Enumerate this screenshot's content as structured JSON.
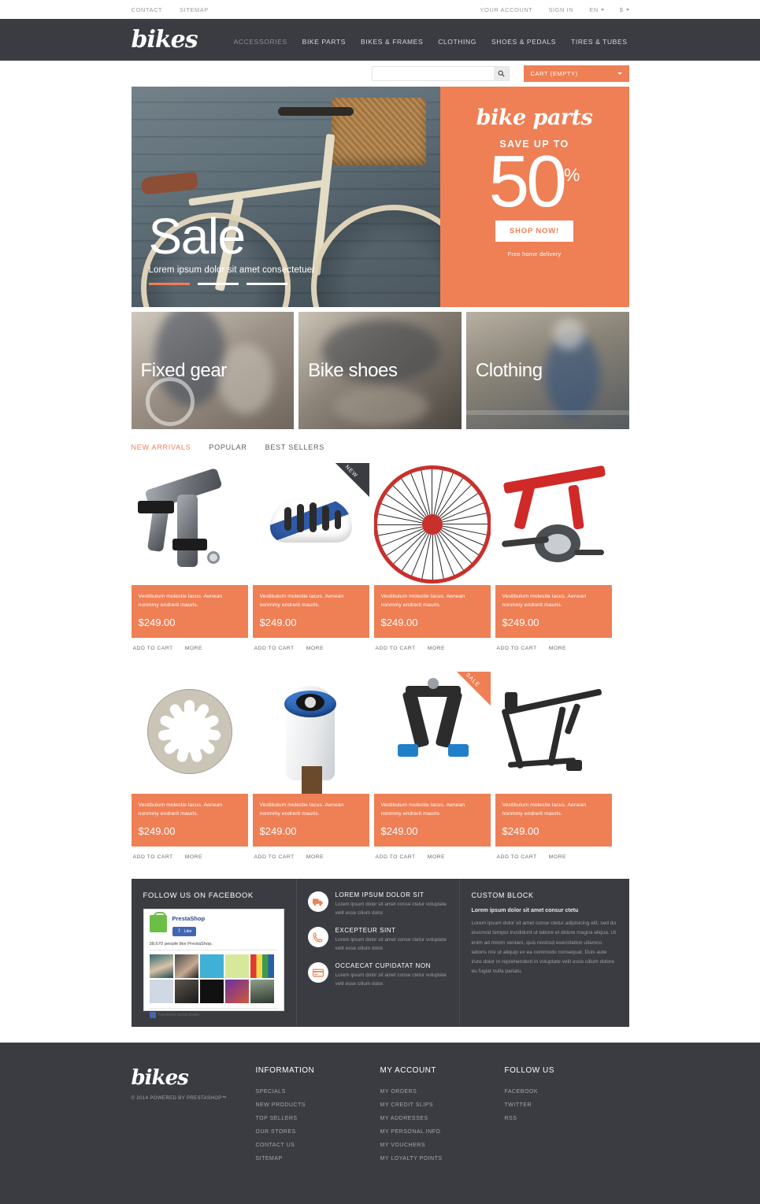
{
  "topbar": {
    "left": [
      {
        "label": "CONTACT"
      },
      {
        "label": "SITEMAP"
      }
    ],
    "right": [
      {
        "label": "YOUR ACCOUNT"
      },
      {
        "label": "SIGN IN"
      }
    ],
    "language": "EN",
    "currency": "$"
  },
  "header": {
    "logo": "bikes",
    "nav": [
      {
        "label": "ACCESSORIES",
        "active": true
      },
      {
        "label": "BIKE PARTS",
        "active": false
      },
      {
        "label": "BIKES & FRAMES",
        "active": false
      },
      {
        "label": "CLOTHING",
        "active": false
      },
      {
        "label": "SHOES & PEDALS",
        "active": false
      },
      {
        "label": "TIRES & TUBES",
        "active": false
      }
    ]
  },
  "search": {
    "value": "",
    "placeholder": "",
    "icon": "search-icon"
  },
  "cart": {
    "label": "CART (EMPTY)"
  },
  "hero": {
    "title": "Sale",
    "subtitle": "Lorem ipsum dolor sit amet consectetuer",
    "slides": 3,
    "active_slide": 1,
    "promo": {
      "script": "bike parts",
      "save_up_to": "SAVE UP TO",
      "percent_number": "50",
      "percent_symbol": "%",
      "button": "SHOP NOW!",
      "note": "Free home delivery",
      "bg_color": "#ef7f55"
    }
  },
  "categories": [
    {
      "label": "Fixed gear"
    },
    {
      "label": "Bike shoes"
    },
    {
      "label": "Clothing"
    }
  ],
  "product_tabs": [
    {
      "label": "NEW ARRIVALS",
      "active": true
    },
    {
      "label": "POPULAR",
      "active": false
    },
    {
      "label": "BEST SELLERS",
      "active": false
    }
  ],
  "product_actions": {
    "add_to_cart": "ADD TO CART",
    "more": "MORE"
  },
  "product_description": "Vestibulum molestie lacus. Aenean nonmmy endrerit mauris.",
  "products": [
    {
      "art": "caliper",
      "badge": null,
      "price": "$249.00"
    },
    {
      "art": "helmet",
      "badge": "NEW",
      "badge_color": "#3a3c41",
      "price": "$249.00"
    },
    {
      "art": "wheel",
      "badge": null,
      "price": "$249.00"
    },
    {
      "art": "redbike",
      "badge": null,
      "price": "$249.00"
    },
    {
      "art": "rotor",
      "badge": null,
      "price": "$249.00"
    },
    {
      "art": "fork",
      "badge": null,
      "price": "$249.00"
    },
    {
      "art": "brake",
      "badge": "SALE",
      "badge_color": "#ef7f55",
      "price": "$249.00"
    },
    {
      "art": "frame",
      "badge": null,
      "price": "$249.00"
    }
  ],
  "facebook": {
    "heading": "FOLLOW US ON FACEBOOK",
    "page_name": "PrestaShop",
    "like_label": "Like",
    "count_text": "38,670 people like PrestaShop.",
    "plugin_label": "Facebook social plugin"
  },
  "services": [
    {
      "icon": "truck-icon",
      "title": "LOREM IPSUM DOLOR SIT",
      "text": "Lorem ipsum dolor sit amet conse ctetur voluptate velit esse cilium dolor."
    },
    {
      "icon": "phone-icon",
      "title": "EXCEPTEUR SINT",
      "text": "Lorem ipsum dolor sit amet conse ctetur voluptate velit esse cilium dolor."
    },
    {
      "icon": "credit-card-icon",
      "title": "OCCAECAT CUPIDATAT NON",
      "text": "Lorem ipsum dolor sit amet conse ctetur voluptate velit esse cilium dolor."
    }
  ],
  "custom_block": {
    "heading": "CUSTOM BLOCK",
    "subheading": "Lorem ipsum dolor sit amet consur ctetu",
    "body": "Lorem ipsum dolor sit amet conse ctetur adipisicing elit, sed do eiusmod tempor incididunt ut labore et dolore magna aliqua. Ut enim ad minim veniam, quis nostrud exercitation ullamco laboris nisi ut aliquip ex ea commodo consequat. Duis aute irure dolor in reprehenderit in voluptate velit esse cillum dolore eu fugiat nulla pariatu."
  },
  "footer": {
    "logo": "bikes",
    "copyright": "© 2014 POWERED BY PRESTASHOP™",
    "columns": [
      {
        "title": "INFORMATION",
        "links": [
          {
            "label": "SPECIALS"
          },
          {
            "label": "NEW PRODUCTS"
          },
          {
            "label": "TOP SELLERS"
          },
          {
            "label": "OUR STORES"
          },
          {
            "label": "CONTACT US"
          },
          {
            "label": "SITEMAP"
          }
        ]
      },
      {
        "title": "MY ACCOUNT",
        "links": [
          {
            "label": "MY ORDERS"
          },
          {
            "label": "MY CREDIT SLIPS"
          },
          {
            "label": "MY ADDRESSES"
          },
          {
            "label": "MY PERSONAL INFO"
          },
          {
            "label": "MY VOUCHERS"
          },
          {
            "label": "MY LOYALTY POINTS"
          }
        ]
      },
      {
        "title": "FOLLOW US",
        "links": [
          {
            "label": "FACEBOOK"
          },
          {
            "label": "TWITTER"
          },
          {
            "label": "RSS"
          }
        ]
      }
    ]
  },
  "theme": {
    "accent": "#ef7f55",
    "dark": "#3a3c41",
    "muted": "#9a9a9a"
  }
}
